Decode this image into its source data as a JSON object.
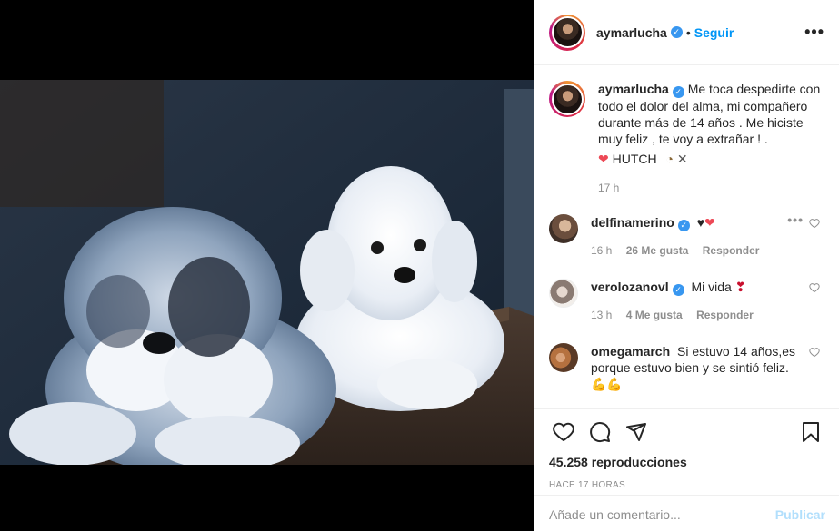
{
  "post": {
    "username": "aymarlucha",
    "follow_label": "Seguir",
    "more_label": "•••"
  },
  "caption": {
    "username": "aymarlucha",
    "text": "Me toca despedirte con todo el dolor del alma, mi compañero durante más de 14 años . Me hiciste muy feliz , te voy a extrañar ! .",
    "signoff": "HUTCH",
    "time": "17 h"
  },
  "comments": [
    {
      "username": "delfinamerino",
      "verified": true,
      "text": "",
      "time": "16 h",
      "likes": "26 Me gusta",
      "reply": "Responder"
    },
    {
      "username": "verolozanovl",
      "verified": true,
      "text": "Mi vida",
      "time": "13 h",
      "likes": "4 Me gusta",
      "reply": "Responder"
    },
    {
      "username": "omegamarch",
      "verified": false,
      "text": "Si estuvo 14 años,es porque estuvo bien y se sintió feliz.",
      "time": "",
      "likes": "",
      "reply": ""
    }
  ],
  "stats": {
    "views": "45.258 reproducciones",
    "ago": "HACE 17 HORAS"
  },
  "add_comment": {
    "placeholder": "Añade un comentario...",
    "publish": "Publicar"
  },
  "colors": {
    "accent": "#0095f6",
    "verified": "#3897f0",
    "muted": "#8e8e8e",
    "heart": "#ed4956"
  },
  "icons": [
    "heart-icon",
    "comment-icon",
    "share-icon",
    "bookmark-icon",
    "verified-icon",
    "more-icon"
  ]
}
